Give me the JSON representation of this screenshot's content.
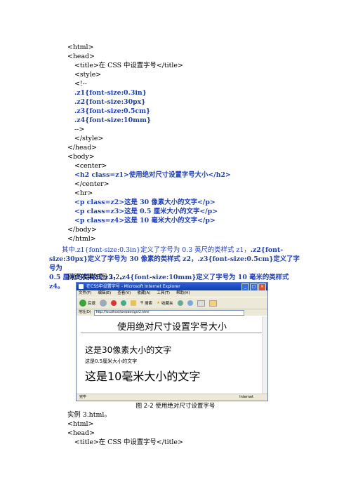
{
  "code_lines_top": [
    {
      "text": "<html>",
      "indent": 0,
      "bold": false
    },
    {
      "text": "<head>",
      "indent": 0,
      "bold": false
    },
    {
      "text": "<title>在 CSS 中设置字号</title>",
      "indent": 1,
      "bold": false
    },
    {
      "text": "<style>",
      "indent": 1,
      "bold": false
    },
    {
      "text": "<!--",
      "indent": 1,
      "bold": false
    },
    {
      "text": ".z1{font-size:0.3in}",
      "indent": 1,
      "bold": true
    },
    {
      "text": ".z2{font-size:30px}",
      "indent": 1,
      "bold": true
    },
    {
      "text": ".z3{font-size:0.5cm}",
      "indent": 1,
      "bold": true
    },
    {
      "text": ".z4{font-size:10mm}",
      "indent": 1,
      "bold": true
    },
    {
      "text": "-->",
      "indent": 1,
      "bold": false
    },
    {
      "text": "</style>",
      "indent": 1,
      "bold": false
    },
    {
      "text": "</head>",
      "indent": 0,
      "bold": false
    },
    {
      "text": "<body>",
      "indent": 0,
      "bold": false
    },
    {
      "text": "<center>",
      "indent": 1,
      "bold": false
    },
    {
      "text": "<h2 class=z1>使用绝对尺寸设置字号大小</h2>",
      "indent": 1,
      "bold": true
    },
    {
      "text": "</center>",
      "indent": 1,
      "bold": false
    },
    {
      "text": "<hr>",
      "indent": 1,
      "bold": false
    },
    {
      "text": "<p class=z2>这是 30 像素大小的文字</p>",
      "indent": 1,
      "bold": true
    },
    {
      "text": "<p class=z3>这是 0.5 厘米大小的文字</p>",
      "indent": 1,
      "bold": true
    },
    {
      "text": "<p class=z4>这是 10 毫米大小的文字</p>",
      "indent": 1,
      "bold": true
    },
    {
      "text": "</body>",
      "indent": 0,
      "bold": false
    },
    {
      "text": "</html>",
      "indent": 0,
      "bold": false
    }
  ],
  "explanation": {
    "line1_normal": "其中.z1{font-size:0.3in}定义了字号为 0.3 英尺的类样式 z1，",
    "line1_bold": ".z2{font-",
    "line2_bold": "size:30px}定义了字号为 30 像素的类样式 z2，.z3{font-size:0.5cm}定义了字号为",
    "line3_bold": "0.5 厘米的类样式 z3，.z4{font-size:10mm}定义了字号为 10 毫米的类样式 z4。",
    "effect_line": "网页效果如图 2-2。"
  },
  "browser": {
    "title": "在CSS中设置字号 - Microsoft Internet Explorer",
    "menu": [
      "文件(F)",
      "编辑(E)",
      "查看(V)",
      "收藏(A)",
      "工具(T)",
      "帮助(H)"
    ],
    "toolbar": {
      "back": "后退",
      "search": "搜索",
      "favorites": "收藏夹"
    },
    "address_label": "地址(D)",
    "address_value": "http://localhost/webdesign/2.html",
    "heading": "使用绝对尺寸设置字号大小",
    "p30": "这是30像素大小的文字",
    "p05": "这是0.5厘米大小的文字",
    "p10": "这是10毫米大小的文字",
    "status_left": "完毕",
    "status_right": "Internet"
  },
  "figure_caption": "图 2-2  使用绝对尺寸设置字号",
  "code_lines_bottom": [
    {
      "text": "实例 3.html。",
      "indent": 0
    },
    {
      "text": "<html>",
      "indent": 0
    },
    {
      "text": "<head>",
      "indent": 0
    },
    {
      "text": "<title>在 CSS 中设置字号</title>",
      "indent": 1
    }
  ]
}
